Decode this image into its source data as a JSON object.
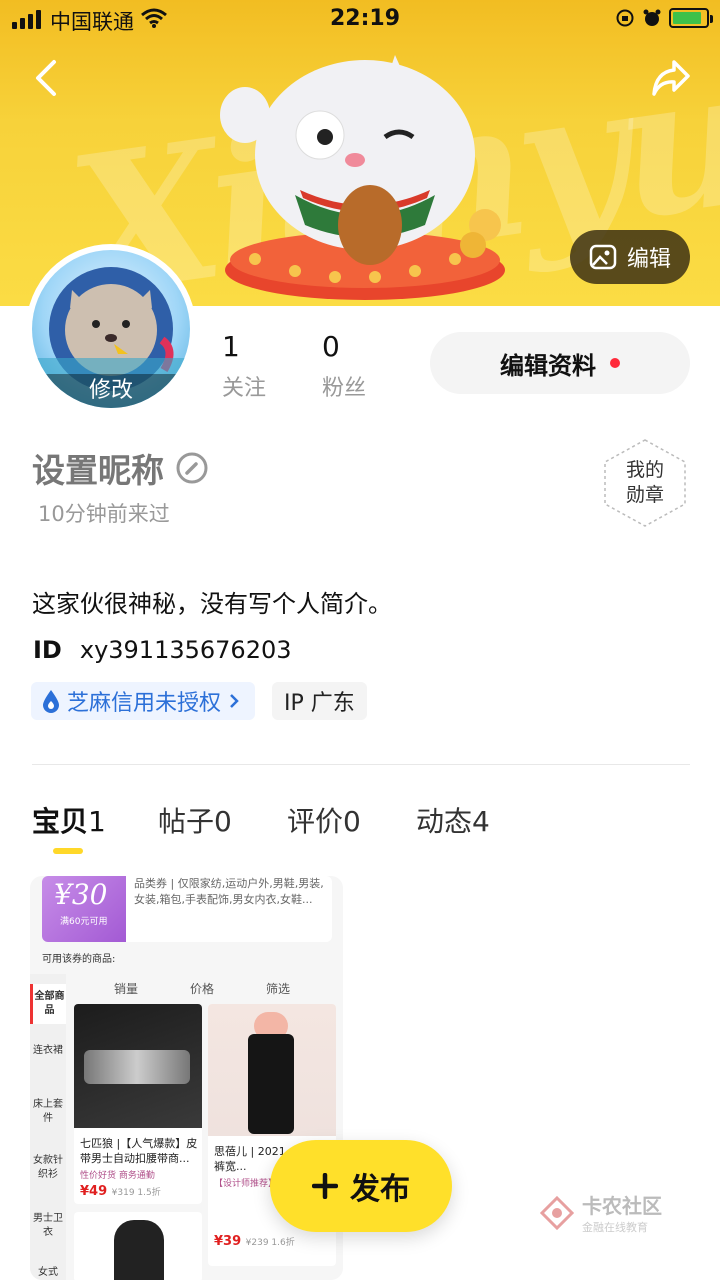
{
  "status_bar": {
    "carrier": "中国联通",
    "time": "22:19"
  },
  "header": {
    "back_icon": "back-icon",
    "share_icon": "share-icon",
    "edit_cover_label": "编辑"
  },
  "avatar": {
    "modify_label": "修改"
  },
  "stats": [
    {
      "value": "1",
      "label": "关注"
    },
    {
      "value": "0",
      "label": "粉丝"
    }
  ],
  "edit_profile_label": "编辑资料",
  "profile": {
    "nickname": "设置昵称",
    "last_seen": "10分钟前来过",
    "medal_label_1": "我的",
    "medal_label_2": "勋章",
    "bio": "这家伙很神秘，没有写个人简介。",
    "id_label": "ID",
    "id_value": "xy391135676203",
    "sesame_label": "芝麻信用未授权",
    "ip_label": "IP 广东"
  },
  "tabs": [
    {
      "label": "宝贝",
      "count": "1"
    },
    {
      "label": "帖子",
      "count": "0"
    },
    {
      "label": "评价",
      "count": "0"
    },
    {
      "label": "动态",
      "count": "4"
    }
  ],
  "listing": {
    "coupon_value": "¥30",
    "coupon_sub": "满60元可用",
    "coupon_desc": "品类券 | 仅限家纺,运动户外,男鞋,男装,女装,箱包,手表配饰,男女内衣,女鞋...",
    "usable": "可用该券的商品:",
    "sort_sales": "销量",
    "sort_price": "价格",
    "sort_filter": "筛选",
    "categories": [
      "全部商品",
      "连衣裙",
      "床上套件",
      "女款针织衫",
      "男士卫衣",
      "女式"
    ],
    "products": [
      {
        "title": "七匹狼 |【人气爆款】皮带男士自动扣腰带商...",
        "tag": "性价好货  商务通勤",
        "price": "¥49",
        "old": "¥319  1.5折"
      },
      {
        "title": "思蓓儿 | 2021...百搭女裤宽...",
        "tag": "【设计师推荐】",
        "price": "¥39",
        "old": "¥239  1.6折"
      }
    ]
  },
  "publish_label": "发布",
  "watermark": {
    "title": "卡农社区",
    "subtitle": "金融在线教育"
  },
  "colors": {
    "accent": "#ffe02a",
    "banner": "#f7d23a",
    "link": "#2c70d8",
    "badge_dot": "#ff2a3a"
  }
}
